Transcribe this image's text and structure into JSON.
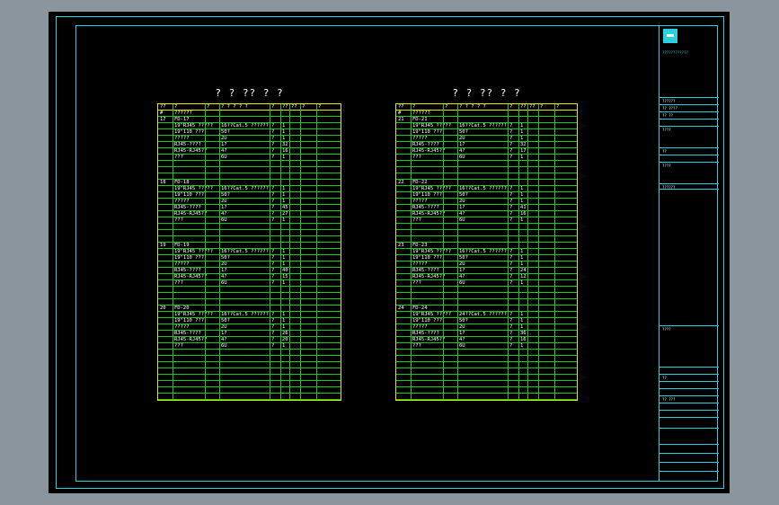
{
  "tables": [
    {
      "title": "? ? ?? ? ?",
      "header": [
        "??",
        "?",
        "?",
        "? ? ? ? ?",
        "?",
        "??",
        "??",
        "?",
        "?"
      ],
      "top_row": [
        "#",
        "??????"
      ],
      "groups": [
        {
          "num": "17",
          "name": "FD-17",
          "items": [
            [
              "19\"RJ45 ?????",
              "16??Cat.5 ??????",
              "?",
              "1"
            ],
            [
              "19\"110 ???",
              "50?",
              "?",
              "1"
            ],
            [
              "?????",
              "2U",
              "?",
              "1"
            ],
            [
              "RJ45-????",
              "1?",
              "?",
              "32"
            ],
            [
              "RJ45-RJ45??",
              "4?",
              "?",
              "16"
            ],
            [
              "???",
              "6U",
              "?",
              "1"
            ]
          ]
        },
        {
          "num": "18",
          "name": "FD-18",
          "items": [
            [
              "19\"RJ45 ?????",
              "16??Cat.5 ??????",
              "?",
              "1"
            ],
            [
              "19\"110 ???",
              "50?",
              "?",
              "1"
            ],
            [
              "?????",
              "2U",
              "?",
              "1"
            ],
            [
              "RJ45-????",
              "1?",
              "?",
              "45"
            ],
            [
              "RJ45-RJ45??",
              "4?",
              "?",
              "27"
            ],
            [
              "???",
              "6U",
              "?",
              "1"
            ]
          ]
        },
        {
          "num": "19",
          "name": "FD-19",
          "items": [
            [
              "19\"RJ45 ?????",
              "16??Cat.5 ??????",
              "?",
              "1"
            ],
            [
              "19\"110 ???",
              "50?",
              "?",
              "1"
            ],
            [
              "?????",
              "2U",
              "?",
              "1"
            ],
            [
              "RJ45-????",
              "1?",
              "?",
              "40"
            ],
            [
              "RJ45-RJ45??",
              "4?",
              "?",
              "15"
            ],
            [
              "???",
              "6U",
              "?",
              "1"
            ]
          ]
        },
        {
          "num": "20",
          "name": "FD-20",
          "items": [
            [
              "19\"RJ45 ?????",
              "16??Cat.5 ??????",
              "?",
              "1"
            ],
            [
              "19\"110 ???",
              "50?",
              "?",
              "1"
            ],
            [
              "?????",
              "2U",
              "?",
              "1"
            ],
            [
              "RJ45-????",
              "1?",
              "?",
              "26"
            ],
            [
              "RJ45-RJ45??",
              "4?",
              "?",
              "20"
            ],
            [
              "???",
              "6U",
              "?",
              "1"
            ]
          ]
        }
      ]
    },
    {
      "title": "? ? ?? ? ?",
      "header": [
        "??",
        "?",
        "?",
        "? ? ? ? ?",
        "?",
        "??",
        "??",
        "?",
        "?"
      ],
      "top_row": [
        "#",
        "??????"
      ],
      "groups": [
        {
          "num": "21",
          "name": "FD-21",
          "items": [
            [
              "19\"RJ45 ?????",
              "16??Cat.5 ??????",
              "?",
              "1"
            ],
            [
              "19\"110 ???",
              "50?",
              "?",
              "1"
            ],
            [
              "?????",
              "2U",
              "?",
              "1"
            ],
            [
              "RJ45-????",
              "1?",
              "?",
              "32"
            ],
            [
              "RJ45-RJ45??",
              "4?",
              "?",
              "17"
            ],
            [
              "???",
              "6U",
              "?",
              "1"
            ]
          ]
        },
        {
          "num": "22",
          "name": "FD-22",
          "items": [
            [
              "19\"RJ45 ?????",
              "16??Cat.5 ??????",
              "?",
              "1"
            ],
            [
              "19\"110 ???",
              "50?",
              "?",
              "1"
            ],
            [
              "?????",
              "2U",
              "?",
              "1"
            ],
            [
              "RJ45-????",
              "1?",
              "?",
              "41"
            ],
            [
              "RJ45-RJ45??",
              "4?",
              "?",
              "16"
            ],
            [
              "???",
              "6U",
              "?",
              "1"
            ]
          ]
        },
        {
          "num": "23",
          "name": "FD-23",
          "items": [
            [
              "19\"RJ45 ?????",
              "16??Cat.5 ??????",
              "?",
              "1"
            ],
            [
              "19\"110 ???",
              "50?",
              "?",
              "1"
            ],
            [
              "?????",
              "2U",
              "?",
              "1"
            ],
            [
              "RJ45-????",
              "1?",
              "?",
              "24"
            ],
            [
              "RJ45-RJ45??",
              "4?",
              "?",
              "12"
            ],
            [
              "???",
              "6U",
              "?",
              "1"
            ]
          ]
        },
        {
          "num": "24",
          "name": "FD-24",
          "items": [
            [
              "19\"RJ45 ?????",
              "24??Cat.5 ??????",
              "?",
              "1"
            ],
            [
              "19\"110 ???",
              "50?",
              "?",
              "1"
            ],
            [
              "?????",
              "2U",
              "?",
              "1"
            ],
            [
              "RJ45-????",
              "1?",
              "?",
              "36"
            ],
            [
              "RJ45-RJ45??",
              "4?",
              "?",
              "16"
            ],
            [
              "???",
              "6U",
              "?",
              "1"
            ]
          ]
        }
      ]
    }
  ],
  "title_block": {
    "company": "????????????",
    "texts": [
      "??????",
      "?? ????",
      "?? ??",
      "????",
      "??",
      "????",
      "??????",
      "????",
      "??",
      "?? ???"
    ]
  },
  "colors": {
    "frame": "#2ad0e0",
    "table_border": "#e6e600",
    "grid": "#19c819",
    "background": "#000000"
  }
}
